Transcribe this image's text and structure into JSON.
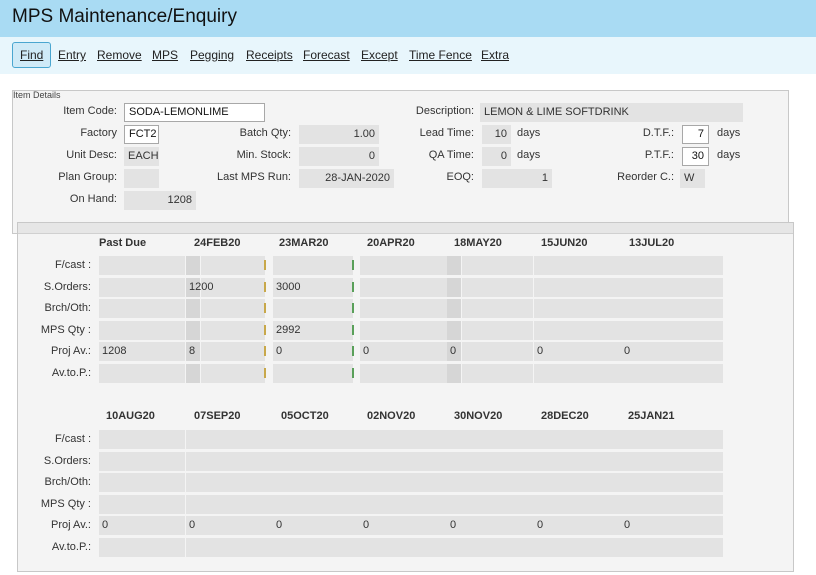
{
  "window": {
    "title": "MPS Maintenance/Enquiry"
  },
  "menu": {
    "find": "Find",
    "entry": "Entry",
    "remove": "Remove",
    "mps": "MPS",
    "pegging": "Pegging",
    "receipts": "Receipts",
    "forecast": "Forecast",
    "except": "Except",
    "time_fence": "Time Fence",
    "extra": "Extra"
  },
  "details": {
    "group_title": "Item Details",
    "item_code_label": "Item Code:",
    "item_code": "SODA-LEMONLIME",
    "description_label": "Description:",
    "description": "LEMON & LIME SOFTDRINK",
    "factory_label": "Factory",
    "factory": "FCT2",
    "batch_qty_label": "Batch Qty:",
    "batch_qty": "1.00",
    "lead_time_label": "Lead Time:",
    "lead_time": "10",
    "lead_time_unit": "days",
    "dtf_label": "D.T.F.:",
    "dtf": "7",
    "dtf_unit": "days",
    "unit_desc_label": "Unit Desc:",
    "unit_desc": "EACH",
    "min_stock_label": "Min. Stock:",
    "min_stock": "0",
    "qa_time_label": "QA Time:",
    "qa_time": "0",
    "qa_time_unit": "days",
    "ptf_label": "P.T.F.:",
    "ptf": "30",
    "ptf_unit": "days",
    "plan_group_label": "Plan Group:",
    "plan_group": "",
    "last_mps_run_label": "Last MPS Run:",
    "last_mps_run": "28-JAN-2020",
    "eoq_label": "EOQ:",
    "eoq": "1",
    "reorder_label": "Reorder C.:",
    "reorder": "W",
    "on_hand_label": "On Hand:",
    "on_hand": "1208"
  },
  "grid1": {
    "headers": [
      "Past Due",
      "24FEB20",
      "23MAR20",
      "20APR20",
      "18MAY20",
      "15JUN20",
      "13JUL20"
    ],
    "rows": [
      {
        "label": "F/cast :",
        "cells": [
          "",
          "",
          "",
          "",
          "",
          "",
          "",
          "",
          ""
        ]
      },
      {
        "label": "S.Orders:",
        "cells": [
          "",
          "1200",
          "3000",
          "",
          "",
          "",
          "",
          "",
          ""
        ]
      },
      {
        "label": "Brch/Oth:",
        "cells": [
          "",
          "",
          "",
          "",
          "",
          "",
          "",
          "",
          ""
        ]
      },
      {
        "label": "MPS Qty :",
        "cells": [
          "",
          "",
          "2992",
          "",
          "",
          "",
          "",
          "",
          ""
        ]
      },
      {
        "label": "Proj Av.:",
        "cells": [
          "1208",
          "8",
          "0",
          "0",
          "0",
          "0",
          "0",
          "",
          ""
        ]
      },
      {
        "label": "Av.to.P.:",
        "cells": [
          "",
          "",
          "",
          "",
          "",
          "",
          "",
          "",
          ""
        ]
      }
    ]
  },
  "grid2": {
    "headers": [
      "10AUG20",
      "07SEP20",
      "05OCT20",
      "02NOV20",
      "30NOV20",
      "28DEC20",
      "25JAN21"
    ],
    "rows": [
      {
        "label": "F/cast :",
        "cells": [
          "",
          "",
          "",
          "",
          "",
          "",
          ""
        ]
      },
      {
        "label": "S.Orders:",
        "cells": [
          "",
          "",
          "",
          "",
          "",
          "",
          ""
        ]
      },
      {
        "label": "Brch/Oth:",
        "cells": [
          "",
          "",
          "",
          "",
          "",
          "",
          ""
        ]
      },
      {
        "label": "MPS Qty :",
        "cells": [
          "",
          "",
          "",
          "",
          "",
          "",
          ""
        ]
      },
      {
        "label": "Proj Av.:",
        "cells": [
          "0",
          "0",
          "0",
          "0",
          "0",
          "0",
          "0"
        ]
      },
      {
        "label": "Av.to.P.:",
        "cells": [
          "",
          "",
          "",
          "",
          "",
          "",
          ""
        ]
      }
    ]
  },
  "colors": {
    "title_bar": "#a9dbf3",
    "menu_bar": "#e8f6fc",
    "tick_yellow": "#c8a84a",
    "tick_green": "#5aa05a"
  }
}
